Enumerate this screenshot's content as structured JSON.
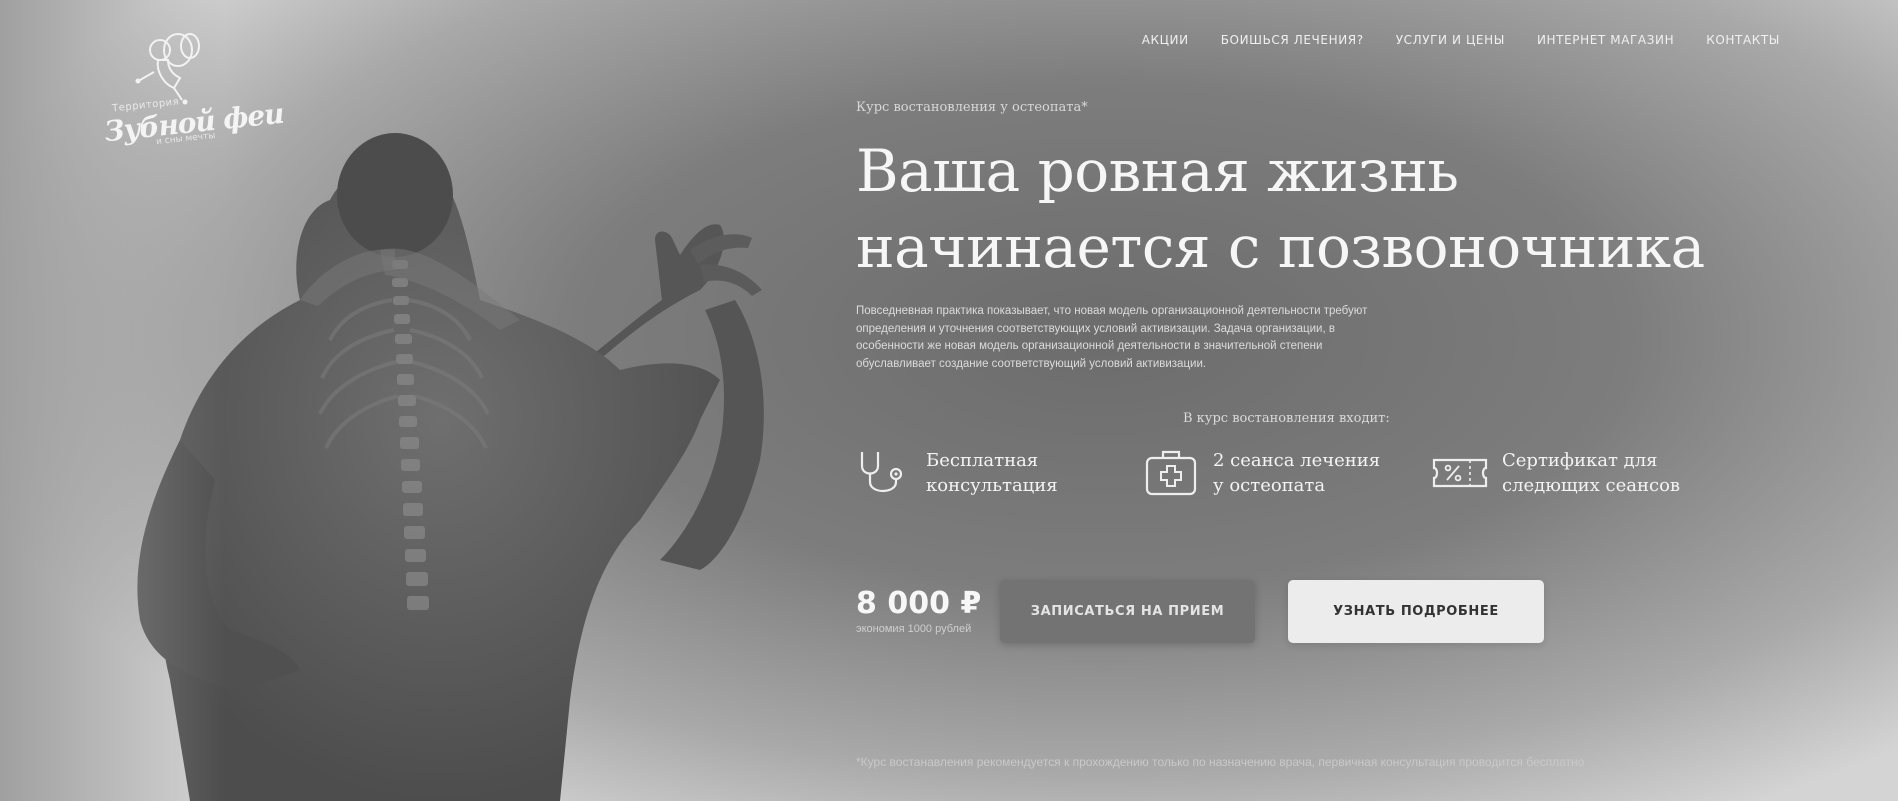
{
  "logo": {
    "top_text": "Территория",
    "main_text": "Зубной феи",
    "bottom_text": "и сны мечты"
  },
  "nav": {
    "items": [
      {
        "label": "Акции"
      },
      {
        "label": "Боишься лечения?"
      },
      {
        "label": "Услуги и цены"
      },
      {
        "label": "Интернет магазин"
      },
      {
        "label": "Контакты"
      }
    ]
  },
  "hero": {
    "eyebrow": "Курс востановления у остеопата*",
    "title_line1": "Ваша ровная жизнь",
    "title_line2": "начинается с позвоночника",
    "description": "Повседневная практика показывает, что новая модель организационной деятельности требуют определения и уточнения соответствующих условий активизации. Задача организации, в особенности же новая модель организационной деятельности в значительной степени обуславливает создание соответствующий условий активизации."
  },
  "includes": {
    "heading": "В курс востановления входит:",
    "features": [
      {
        "icon": "stethoscope-icon",
        "text": "Бесплатная\nконсультация"
      },
      {
        "icon": "first-aid-kit-icon",
        "text": "2 сеанса лечения\nу остеопата"
      },
      {
        "icon": "discount-ticket-icon",
        "text": "Сертификат для\nследющих сеансов"
      }
    ]
  },
  "pricing": {
    "price": "8 000 ₽",
    "note": "экономия 1000 рублей"
  },
  "buttons": {
    "primary": "Записаться на прием",
    "secondary": "Узнать подробнее"
  },
  "footnote": "*Курс востанавления рекомендуется к прохождению только по назначению врача, первичная консультация проводится бесплатно",
  "colors": {
    "background": "#7a7a7a",
    "text": "#f2f2f2",
    "primary_button": "#737373",
    "secondary_button": "#ececec"
  }
}
